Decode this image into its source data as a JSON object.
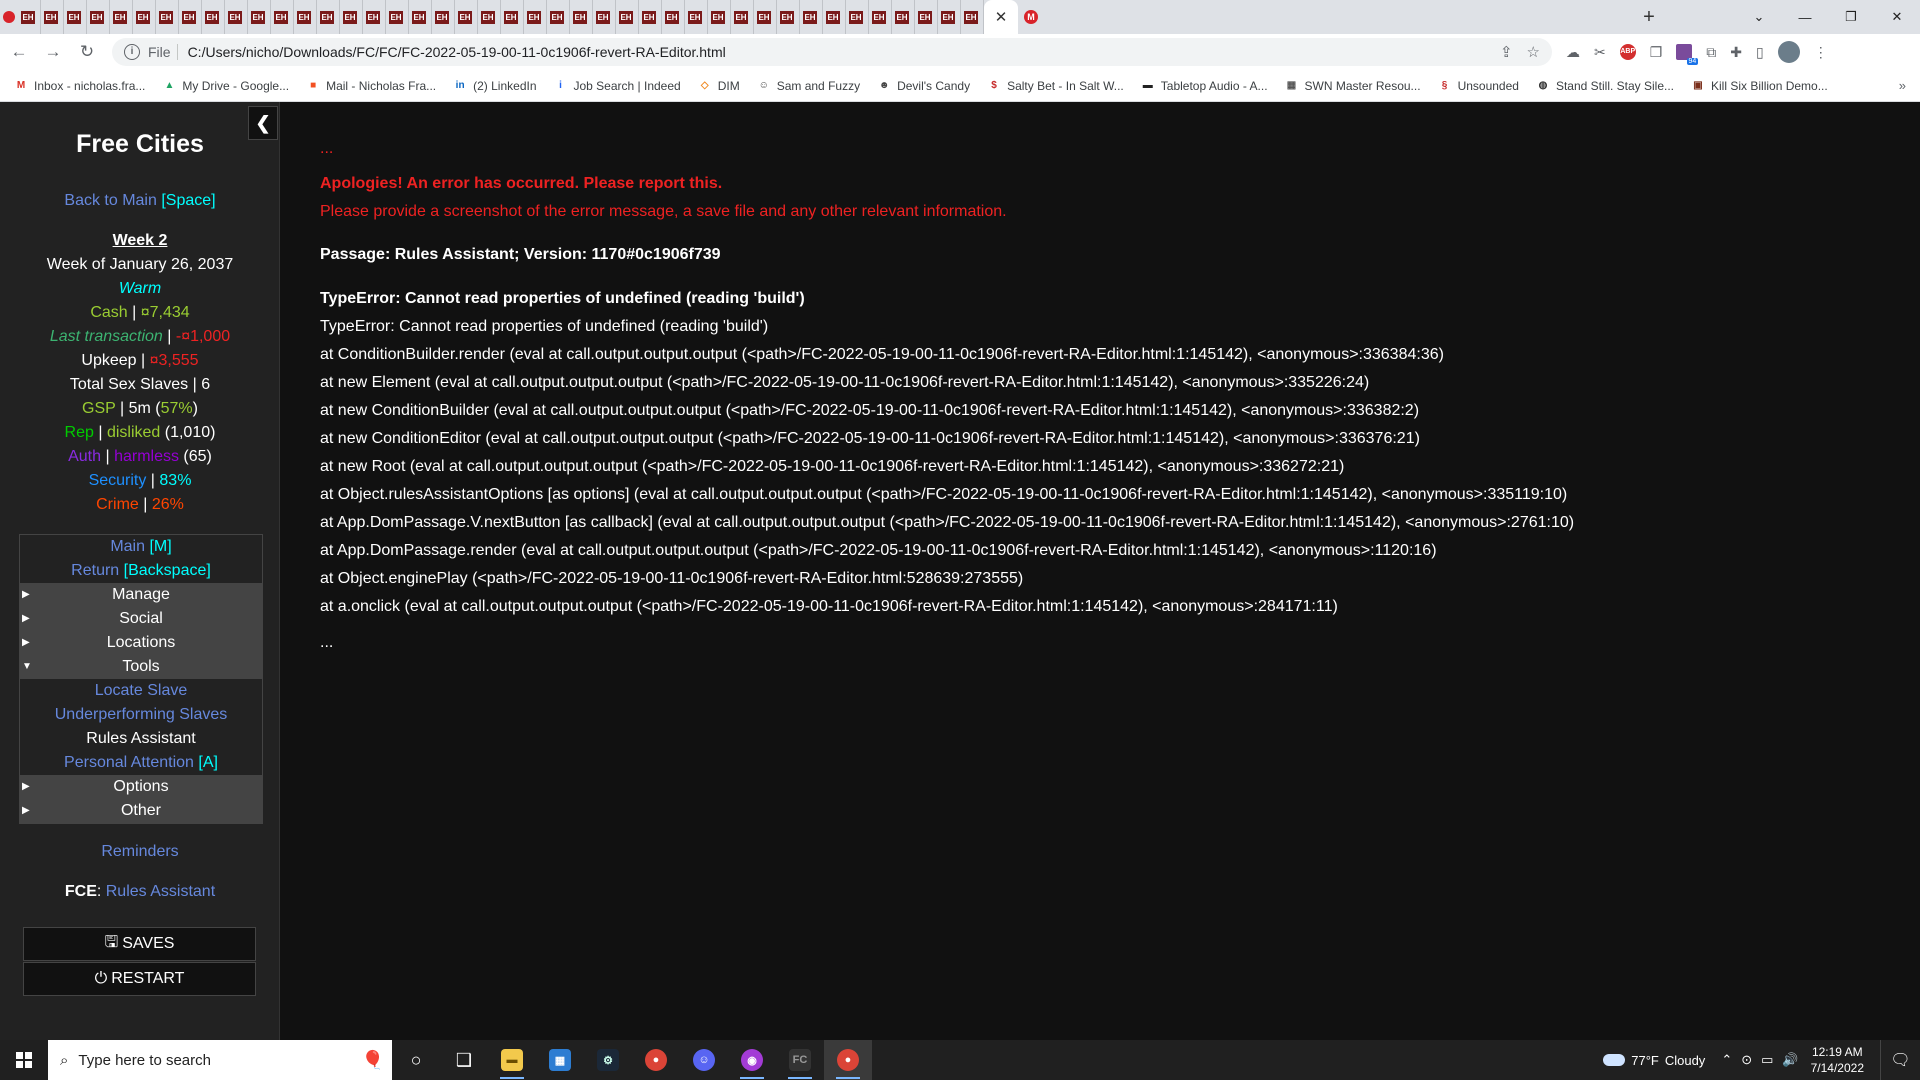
{
  "browser": {
    "tab_label": "EH",
    "tab_count": 42,
    "window_controls": [
      "⌄",
      "—",
      "❐",
      "✕"
    ],
    "address": {
      "scheme": "File",
      "url": "C:/Users/nicho/Downloads/FC/FC/FC-2022-05-19-00-11-0c1906f-revert-RA-Editor.html"
    },
    "bookmarks": [
      {
        "label": "Inbox - nicholas.fra...",
        "icon": "gmail-icon",
        "color": "#d93025",
        "glyph": "M"
      },
      {
        "label": "My Drive - Google...",
        "icon": "drive-icon",
        "color": "#1fa463",
        "glyph": "▲"
      },
      {
        "label": "Mail - Nicholas Fra...",
        "icon": "ms-icon",
        "color": "#f25022",
        "glyph": "■"
      },
      {
        "label": "(2) LinkedIn",
        "icon": "linkedin-icon",
        "color": "#0a66c2",
        "glyph": "in"
      },
      {
        "label": "Job Search | Indeed",
        "icon": "indeed-icon",
        "color": "#2164f3",
        "glyph": "i"
      },
      {
        "label": "DIM",
        "icon": "dim-icon",
        "color": "#f08a24",
        "glyph": "◇"
      },
      {
        "label": "Sam and Fuzzy",
        "icon": "samfuzzy-icon",
        "color": "#444444",
        "glyph": "☺"
      },
      {
        "label": "Devil's Candy",
        "icon": "devil-icon",
        "color": "#444444",
        "glyph": "☻"
      },
      {
        "label": "Salty Bet - In Salt W...",
        "icon": "saltybet-icon",
        "color": "#c62828",
        "glyph": "$"
      },
      {
        "label": "Tabletop Audio - A...",
        "icon": "tabletop-icon",
        "color": "#222222",
        "glyph": "▬"
      },
      {
        "label": "SWN Master Resou...",
        "icon": "swn-icon",
        "color": "#555555",
        "glyph": "▦"
      },
      {
        "label": "Unsounded",
        "icon": "unsounded-icon",
        "color": "#c62828",
        "glyph": "§"
      },
      {
        "label": "Stand Still. Stay Sile...",
        "icon": "standstill-icon",
        "color": "#333333",
        "glyph": "◍"
      },
      {
        "label": "Kill Six Billion Demo...",
        "icon": "killsix-icon",
        "color": "#7a2e1a",
        "glyph": "▣"
      }
    ],
    "more_bookmarks": "»"
  },
  "sidebar": {
    "title": "Free Cities",
    "back": {
      "label": "Back to Main",
      "key": "[Space]"
    },
    "week": "Week 2",
    "date": "Week of January 26, 2037",
    "weather": "Warm",
    "cash": {
      "label": "Cash",
      "sep": " | ",
      "value": "¤7,434"
    },
    "last_transaction": {
      "label": "Last transaction",
      "sep": " | ",
      "value": "-¤1,000"
    },
    "upkeep": {
      "label": "Upkeep",
      "sep": " | ",
      "value": "¤3,555"
    },
    "total_slaves": {
      "label": "Total Sex Slaves",
      "sep": " | ",
      "value": "6"
    },
    "gsp": {
      "label": "GSP",
      "sep": " | ",
      "value": "5m (",
      "pct": "57%",
      "close": ")"
    },
    "rep": {
      "label": "Rep",
      "sep": " | ",
      "value": "disliked",
      "num": " (1,010)"
    },
    "auth": {
      "label": "Auth",
      "sep": " | ",
      "value": "harmless",
      "num": " (65)"
    },
    "security": {
      "label": "Security",
      "sep": " | ",
      "value": "83%"
    },
    "crime": {
      "label": "Crime",
      "sep": " | ",
      "value": "26%"
    },
    "menu": {
      "main": {
        "label": "Main",
        "key": "[M]"
      },
      "return": {
        "label": "Return",
        "key": "[Backspace]"
      },
      "manage": "Manage",
      "social": "Social",
      "locations": "Locations",
      "tools": "Tools",
      "locate_slave": "Locate Slave",
      "underperforming": "Underperforming Slaves",
      "rules_assistant": "Rules Assistant",
      "personal_attention": {
        "label": "Personal Attention",
        "key": "[A]"
      },
      "options": "Options",
      "other": "Other"
    },
    "reminders": "Reminders",
    "fce": {
      "label": "FCE",
      "sep": ": ",
      "link": "Rules Assistant"
    },
    "saves": "SAVES",
    "restart": "RESTART"
  },
  "passage": {
    "ellipsis_top": "...",
    "apology": "Apologies! An error has occurred. Please report this.",
    "provide": "Please provide a screenshot of the error message, a save file and any other relevant information.",
    "passage_info": "Passage: Rules Assistant; Version: 1170#0c1906f739",
    "error_title": "TypeError: Cannot read properties of undefined (reading 'build')",
    "stack": [
      "TypeError: Cannot read properties of undefined (reading 'build')",
      "at ConditionBuilder.render (eval at call.output.output.output (<path>/FC-2022-05-19-00-11-0c1906f-revert-RA-Editor.html:1:145142), <anonymous>:336384:36)",
      "at new Element (eval at call.output.output.output (<path>/FC-2022-05-19-00-11-0c1906f-revert-RA-Editor.html:1:145142), <anonymous>:335226:24)",
      "at new ConditionBuilder (eval at call.output.output.output (<path>/FC-2022-05-19-00-11-0c1906f-revert-RA-Editor.html:1:145142), <anonymous>:336382:2)",
      "at new ConditionEditor (eval at call.output.output.output (<path>/FC-2022-05-19-00-11-0c1906f-revert-RA-Editor.html:1:145142), <anonymous>:336376:21)",
      "at new Root (eval at call.output.output.output (<path>/FC-2022-05-19-00-11-0c1906f-revert-RA-Editor.html:1:145142), <anonymous>:336272:21)",
      "at Object.rulesAssistantOptions [as options] (eval at call.output.output.output (<path>/FC-2022-05-19-00-11-0c1906f-revert-RA-Editor.html:1:145142), <anonymous>:335119:10)",
      "at App.DomPassage.V.nextButton [as callback] (eval at call.output.output.output (<path>/FC-2022-05-19-00-11-0c1906f-revert-RA-Editor.html:1:145142), <anonymous>:2761:10)",
      "at App.DomPassage.render (eval at call.output.output.output (<path>/FC-2022-05-19-00-11-0c1906f-revert-RA-Editor.html:1:145142), <anonymous>:1120:16)",
      "at Object.enginePlay (<path>/FC-2022-05-19-00-11-0c1906f-revert-RA-Editor.html:528639:273555)",
      "at a.onclick (eval at call.output.output.output (<path>/FC-2022-05-19-00-11-0c1906f-revert-RA-Editor.html:1:145142), <anonymous>:284171:11)"
    ],
    "ellipsis_bottom": "..."
  },
  "taskbar": {
    "search_placeholder": "Type here to search",
    "weather": {
      "temp": "77°F",
      "condition": "Cloudy"
    },
    "clock": {
      "time": "12:19 AM",
      "date": "7/14/2022"
    }
  }
}
